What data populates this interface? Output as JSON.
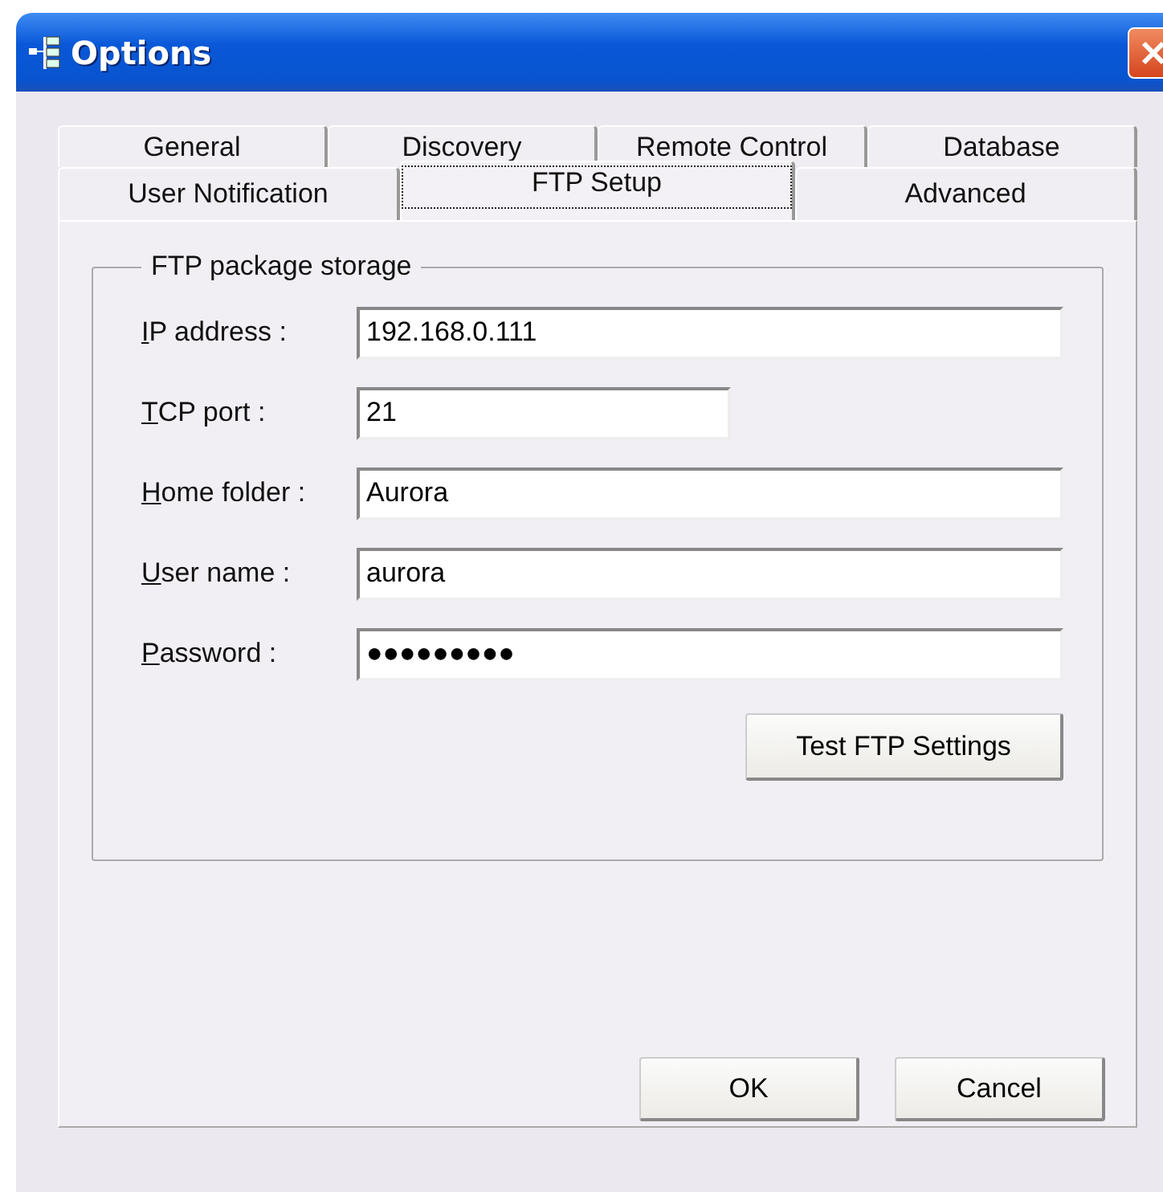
{
  "window": {
    "title": "Options"
  },
  "tab_rows": [
    [
      {
        "label": "General",
        "selected": false
      },
      {
        "label": "Discovery",
        "selected": false
      },
      {
        "label": "Remote Control",
        "selected": false
      },
      {
        "label": "Database",
        "selected": false
      }
    ],
    [
      {
        "label": "User Notification",
        "selected": false
      },
      {
        "label": "FTP Setup",
        "selected": true
      },
      {
        "label": "Advanced",
        "selected": false
      }
    ]
  ],
  "group": {
    "title": "FTP package storage",
    "fields": [
      {
        "label": "IP address :",
        "value": "192.168.0.111",
        "kind": "text"
      },
      {
        "label": "TCP port :",
        "value": "21",
        "kind": "number"
      },
      {
        "label": "Home folder :",
        "value": "Aurora",
        "kind": "text"
      },
      {
        "label": "User name :",
        "value": "aurora",
        "kind": "text"
      },
      {
        "label": "Password :",
        "value": "●●●●●●●●●",
        "kind": "text"
      }
    ],
    "button": "Test FTP Settings"
  },
  "buttons": [
    "OK",
    "Cancel"
  ]
}
